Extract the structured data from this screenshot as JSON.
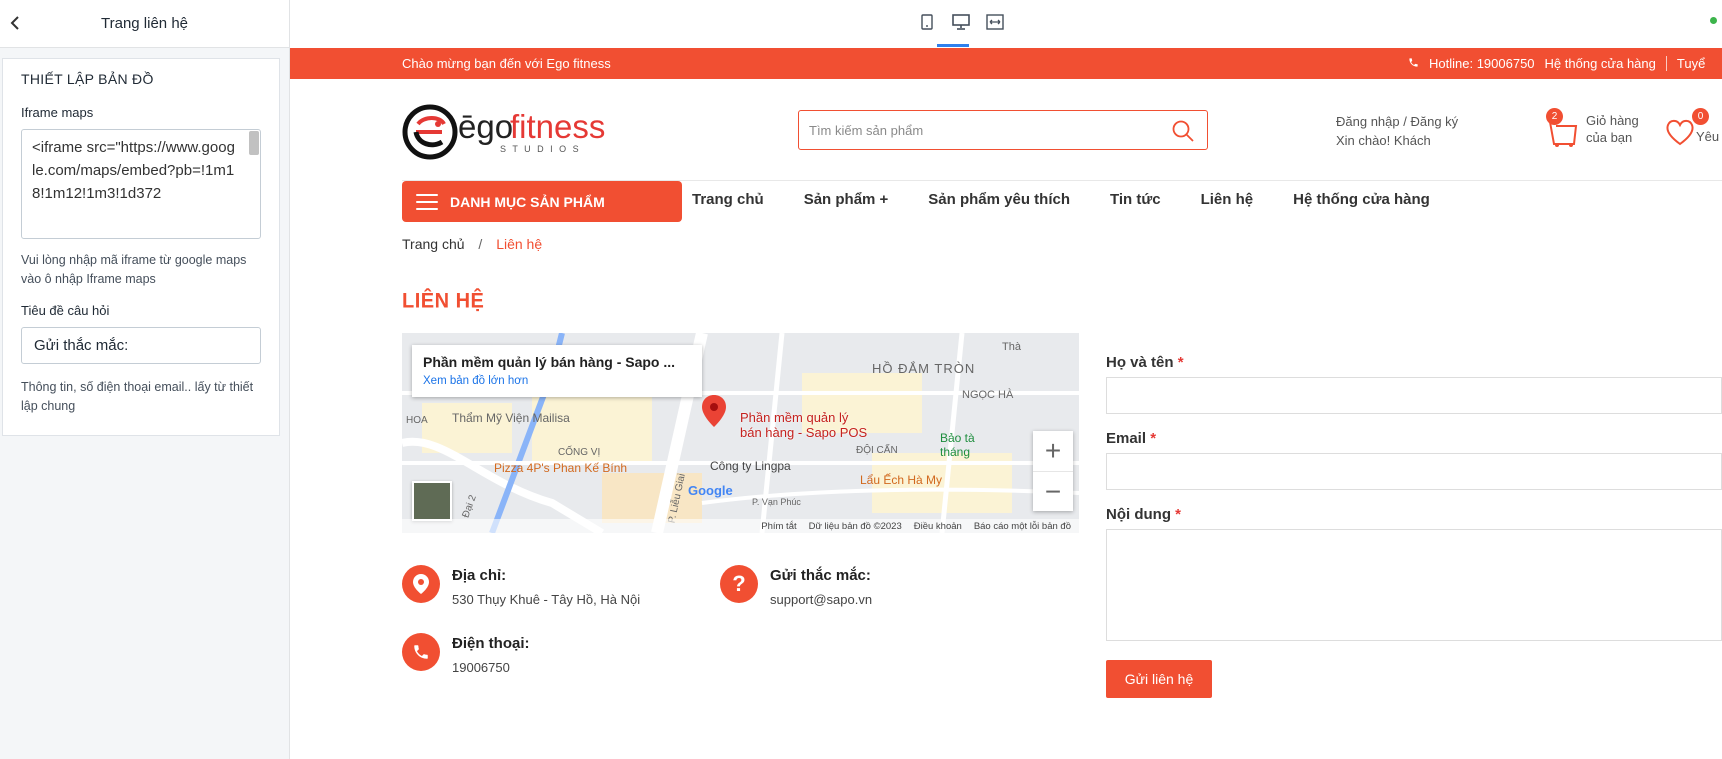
{
  "left_panel": {
    "title": "Trang liên hệ",
    "section_title": "THIẾT LẬP BẢN ĐỒ",
    "iframe_label": "Iframe maps",
    "iframe_value": "<iframe src=\"https://www.google.com/maps/embed?pb=!1m18!1m12!1m3!1d372",
    "iframe_help": "Vui lòng nhập mã iframe từ google maps vào ô nhập Iframe maps",
    "question_label": "Tiêu đề câu hỏi",
    "question_value": "Gửi thắc mắc:",
    "footer_note": "Thông tin, số điện thoại email.. lấy từ thiết lập chung"
  },
  "topbar": {
    "welcome": "Chào mừng bạn đến với Ego fitness",
    "hotline": "Hotline: 19006750",
    "stores": "Hệ thống cửa hàng",
    "extra": "Tuyể"
  },
  "header": {
    "logo_main": "ēgo",
    "logo_brand": "fitness",
    "logo_sub": "S T U D I O S",
    "search_placeholder": "Tìm kiếm sản phẩm",
    "login": "Đăng nhập",
    "register": "Đăng ký",
    "greeting": "Xin chào! Khách",
    "cart_count": "2",
    "cart_line1": "Giỏ hàng",
    "cart_line2": "của bạn",
    "wish_count": "0",
    "wish_label": "Yêu"
  },
  "nav": {
    "category_button": "DANH MỤC SẢN PHẨM",
    "items": [
      "Trang chủ",
      "Sản phẩm +",
      "Sản phẩm yêu thích",
      "Tin tức",
      "Liên hệ",
      "Hệ thống cửa hàng"
    ]
  },
  "breadcrumb": {
    "home": "Trang chủ",
    "separator": "/",
    "current": "Liên hệ"
  },
  "page_title": "LIÊN HỆ",
  "map": {
    "card_title": "Phần mềm quản lý bán hàng - Sapo ...",
    "card_link": "Xem bản đồ lớn hơn",
    "pin_label_1": "Phần mềm quản lý",
    "pin_label_2": "bán hàng - Sapo POS",
    "labels": {
      "area1": "HỒ ĐẮM TRÒN",
      "area2": "NGỌC HÀ",
      "place1": "Thẩm Mỹ Viện Mailisa",
      "area3": "CỐNG VỊ",
      "place2": "Pizza 4P's Phan Kế Bính",
      "place3": "Công ty Lingpa",
      "area4": "ĐỘI CẤN",
      "place4": "Bảo tà",
      "place4b": "tháng",
      "place5": "Lẩu Ếch Hà My",
      "hoa": "HOA",
      "street1": "P. Liễu Giai",
      "street2": "Đại 2",
      "street3": "P. Vạn Phúc",
      "tha": "Thà"
    },
    "zoom_in": "+",
    "zoom_out": "−",
    "google": "Google",
    "footer": [
      "Phím tắt",
      "Dữ liệu bản đồ ©2023",
      "Điều khoản",
      "Báo cáo một lỗi bản đồ"
    ]
  },
  "contact_info": {
    "address_title": "Địa chỉ:",
    "address_value": "530 Thụy Khuê - Tây Hồ, Hà Nội",
    "question_title": "Gửi thắc mắc:",
    "question_value": "support@sapo.vn",
    "phone_title": "Điện thoại:",
    "phone_value": "19006750"
  },
  "form": {
    "name_label": "Họ và tên",
    "email_label": "Email",
    "content_label": "Nội dung",
    "required_mark": "*",
    "submit": "Gửi liên hệ"
  },
  "colors": {
    "accent": "#f14f32",
    "active_tab": "#2f80ed",
    "online": "#3cb44b"
  }
}
